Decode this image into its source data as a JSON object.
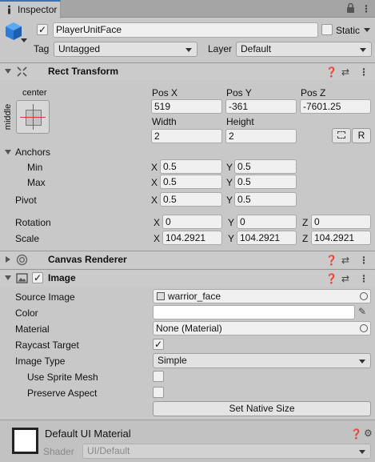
{
  "tab": {
    "label": "Inspector"
  },
  "gameobject": {
    "enabled": true,
    "name": "PlayerUnitFace",
    "static_label": "Static",
    "tag_label": "Tag",
    "tag_value": "Untagged",
    "layer_label": "Layer",
    "layer_value": "Default"
  },
  "rect_transform": {
    "title": "Rect Transform",
    "anchor_preset_h": "center",
    "anchor_preset_v": "middle",
    "pos_x_label": "Pos X",
    "pos_y_label": "Pos Y",
    "pos_z_label": "Pos Z",
    "pos_x": "519",
    "pos_y": "-361",
    "pos_z": "-7601.25",
    "width_label": "Width",
    "height_label": "Height",
    "width": "2",
    "height": "2",
    "raw_button": "R",
    "anchors_label": "Anchors",
    "min_label": "Min",
    "max_label": "Max",
    "min_x": "0.5",
    "min_y": "0.5",
    "max_x": "0.5",
    "max_y": "0.5",
    "pivot_label": "Pivot",
    "pivot_x": "0.5",
    "pivot_y": "0.5",
    "rotation_label": "Rotation",
    "rot_x": "0",
    "rot_y": "0",
    "rot_z": "0",
    "scale_label": "Scale",
    "scale_x": "104.2921",
    "scale_y": "104.2921",
    "scale_z": "104.2921",
    "x": "X",
    "y": "Y",
    "z": "Z"
  },
  "canvas_renderer": {
    "title": "Canvas Renderer"
  },
  "image": {
    "title": "Image",
    "enabled": true,
    "source_image_label": "Source Image",
    "source_image_value": "warrior_face",
    "color_label": "Color",
    "material_label": "Material",
    "material_value": "None (Material)",
    "raycast_label": "Raycast Target",
    "raycast_value": true,
    "image_type_label": "Image Type",
    "image_type_value": "Simple",
    "sprite_mesh_label": "Use Sprite Mesh",
    "preserve_label": "Preserve Aspect",
    "native_size_button": "Set Native Size"
  },
  "material_footer": {
    "title": "Default UI Material",
    "shader_label": "Shader",
    "shader_value": "UI/Default"
  },
  "colors": {
    "panel_bg": "#c8c8c8",
    "tab_accent": "#3a72b0",
    "cube_icon": "#2c7bd6"
  }
}
